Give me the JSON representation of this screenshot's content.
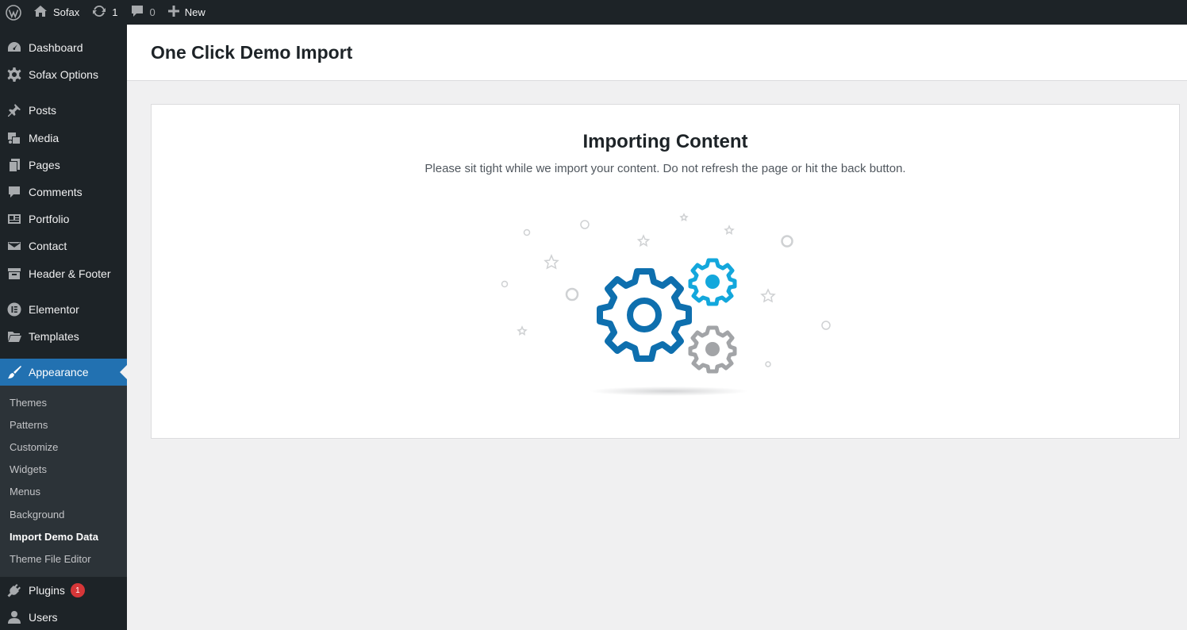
{
  "adminbar": {
    "site_name": "Sofax",
    "updates_count": "1",
    "comments_count": "0",
    "new_label": "New"
  },
  "sidebar": {
    "items": [
      {
        "label": "Dashboard",
        "icon": "dashboard-icon"
      },
      {
        "label": "Sofax Options",
        "icon": "gear-icon"
      },
      {
        "label": "Posts",
        "icon": "pin-icon"
      },
      {
        "label": "Media",
        "icon": "media-icon"
      },
      {
        "label": "Pages",
        "icon": "pages-icon"
      },
      {
        "label": "Comments",
        "icon": "comment-icon"
      },
      {
        "label": "Portfolio",
        "icon": "portfolio-icon"
      },
      {
        "label": "Contact",
        "icon": "mail-icon"
      },
      {
        "label": "Header & Footer",
        "icon": "archive-icon"
      },
      {
        "label": "Elementor",
        "icon": "elementor-icon"
      },
      {
        "label": "Templates",
        "icon": "folder-icon"
      },
      {
        "label": "Appearance",
        "icon": "brush-icon"
      },
      {
        "label": "Plugins",
        "icon": "plug-icon",
        "badge": "1"
      },
      {
        "label": "Users",
        "icon": "user-icon"
      }
    ],
    "appearance_submenu": [
      "Themes",
      "Patterns",
      "Customize",
      "Widgets",
      "Menus",
      "Background",
      "Import Demo Data",
      "Theme File Editor"
    ]
  },
  "page": {
    "title": "One Click Demo Import"
  },
  "importer": {
    "heading": "Importing Content",
    "description": "Please sit tight while we import your content. Do not refresh the page or hit the back button."
  },
  "colors": {
    "accent": "#2271b1",
    "gear_dark_blue": "#0e6fae",
    "gear_light_blue": "#13a7dc",
    "gear_gray": "#a2a4a7"
  }
}
